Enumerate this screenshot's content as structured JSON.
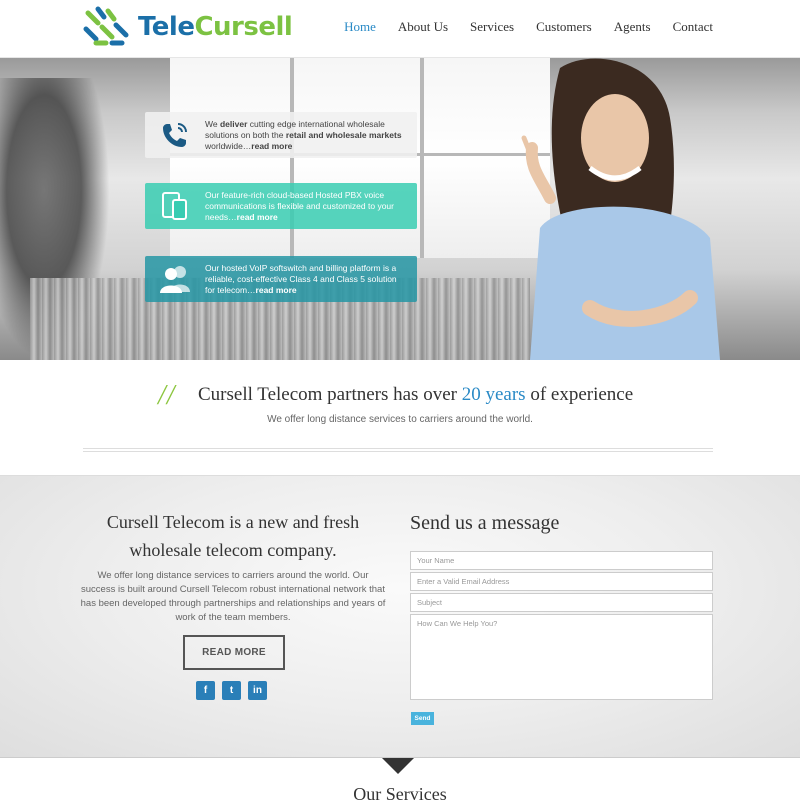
{
  "brand": {
    "name_part1": "Tele",
    "name_part2": "Cursell"
  },
  "nav": {
    "items": [
      {
        "label": "Home",
        "active": true
      },
      {
        "label": "About Us",
        "active": false
      },
      {
        "label": "Services",
        "active": false
      },
      {
        "label": "Customers",
        "active": false
      },
      {
        "label": "Agents",
        "active": false
      },
      {
        "label": "Contact",
        "active": false
      }
    ]
  },
  "hero": {
    "boxes": [
      {
        "icon": "phone-icon",
        "pre": "We ",
        "b1": "deliver",
        "mid": " cutting edge international wholesale solutions on both the ",
        "b2": "retail and wholesale markets",
        "post": " worldwide…",
        "link": "read more"
      },
      {
        "icon": "devices-icon",
        "text": "Our feature-rich cloud-based Hosted PBX voice communications is flexible and customized to your needs…",
        "link": "read more"
      },
      {
        "icon": "users-icon",
        "text": "Our hosted VoIP softswitch and billing platform is a reliable, cost-effective Class 4 and Class 5 solution for telecom…",
        "link": "read more"
      }
    ]
  },
  "experience": {
    "slashes": "//",
    "title_pre": "Cursell Telecom partners has over ",
    "title_highlight": "20 years",
    "title_post": " of experience",
    "subtitle": "We offer long distance services to carriers around the world."
  },
  "about": {
    "title": "Cursell Telecom is a new and fresh wholesale telecom company.",
    "text": "We offer long distance services to carriers around the world. Our success is built around Cursell Telecom robust international network that has been developed through partnerships and relationships and years of work of the team members.",
    "button_label": "READ MORE",
    "socials": [
      {
        "icon": "facebook-icon",
        "glyph": "f"
      },
      {
        "icon": "twitter-icon",
        "glyph": "t"
      },
      {
        "icon": "linkedin-icon",
        "glyph": "in"
      }
    ]
  },
  "contact_form": {
    "title": "Send us a message",
    "name_placeholder": "Your Name",
    "email_placeholder": "Enter a Valid Email Address",
    "subject_placeholder": "Subject",
    "message_placeholder": "How Can We Help You?",
    "send_label": "Send"
  },
  "services": {
    "title": "Our Services"
  },
  "colors": {
    "brand_blue": "#1b6fa8",
    "brand_green": "#7cc242",
    "accent": "#2a8ac6",
    "teal": "#38ccb2"
  }
}
